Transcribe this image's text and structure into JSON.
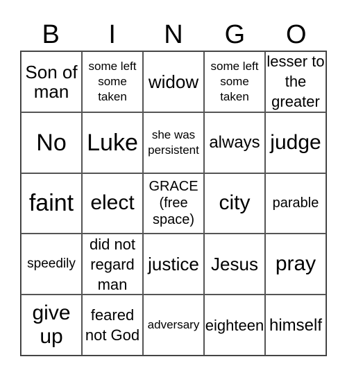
{
  "header": [
    "B",
    "I",
    "N",
    "G",
    "O"
  ],
  "cells": [
    [
      "Son of man",
      "some left some taken",
      "widow",
      "some left some taken",
      "lesser to the greater"
    ],
    [
      "No",
      "Luke",
      "she was persistent",
      "always",
      "judge"
    ],
    [
      "faint",
      "elect",
      "GRACE (free space)",
      "city",
      "parable"
    ],
    [
      "speedily",
      "did not regard man",
      "justice",
      "Jesus",
      "pray"
    ],
    [
      "give up",
      "feared not God",
      "adversary",
      "eighteen",
      "himself"
    ]
  ]
}
